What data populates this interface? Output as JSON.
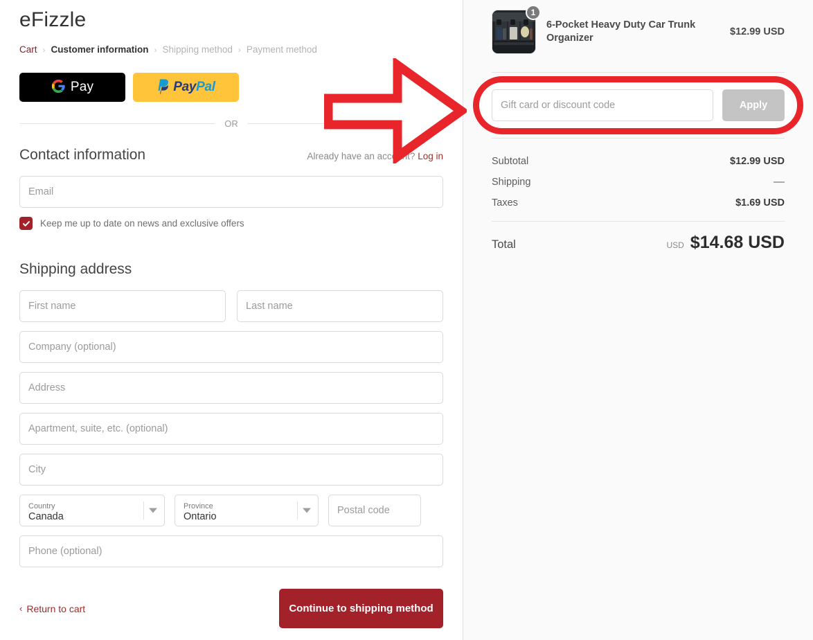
{
  "brand": {
    "name": "eFizzle"
  },
  "breadcrumb": {
    "cart": "Cart",
    "current": "Customer information",
    "shipping": "Shipping method",
    "payment": "Payment method",
    "separator": "›"
  },
  "express_checkout": {
    "gpay_label": "Pay",
    "paypal_pay": "Pay",
    "paypal_pal": "Pal",
    "divider_text": "OR"
  },
  "contact": {
    "title": "Contact information",
    "account_note": "Already have an account?",
    "login_link": "Log in",
    "email_placeholder": "Email",
    "email_value": "",
    "newsletter_label": "Keep me up to date on news and exclusive offers",
    "newsletter_checked": true
  },
  "shipping_address": {
    "title": "Shipping address",
    "first_name_placeholder": "First name",
    "last_name_placeholder": "Last name",
    "company_placeholder": "Company (optional)",
    "address_placeholder": "Address",
    "apartment_placeholder": "Apartment, suite, etc. (optional)",
    "city_placeholder": "City",
    "country_label": "Country",
    "country_value": "Canada",
    "province_label": "Province",
    "province_value": "Ontario",
    "postal_placeholder": "Postal code",
    "phone_placeholder": "Phone (optional)"
  },
  "actions": {
    "return_to_cart": "Return to cart",
    "return_chevron": "‹",
    "continue": "Continue to shipping method"
  },
  "order_summary": {
    "item": {
      "name": "6-Pocket Heavy Duty Car Trunk Organizer",
      "quantity": "1",
      "price": "$12.99 USD",
      "image_alt": "car-trunk-organizer-photo"
    },
    "discount": {
      "placeholder": "Gift card or discount code",
      "value": "",
      "apply_label": "Apply"
    },
    "lines": [
      {
        "label": "Subtotal",
        "value": "$12.99 USD"
      },
      {
        "label": "Shipping",
        "value": "—"
      },
      {
        "label": "Taxes",
        "value": "$1.69 USD"
      }
    ],
    "total": {
      "label": "Total",
      "currency": "USD",
      "value": "$14.68 USD"
    }
  },
  "annotations": {
    "arrow_color": "#e8252a",
    "box_color": "#e8252a",
    "arrow_name": "red-arrow-pointing-to-discount-field",
    "box_name": "red-highlight-box-discount-field"
  },
  "colors": {
    "accent": "#a32128",
    "paypal_gold": "#ffc439",
    "panel_bg": "#fafafa",
    "apply_disabled": "#c4c4c4"
  }
}
